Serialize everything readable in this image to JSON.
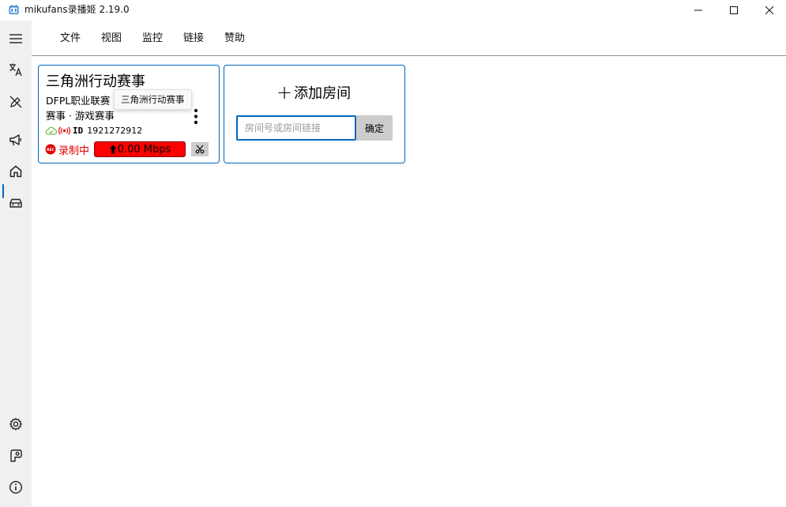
{
  "window": {
    "title": "mikufans录播姬 2.19.0",
    "controls": [
      "minimize",
      "maximize",
      "close"
    ]
  },
  "sidebar": {
    "top_items": [
      {
        "name": "hamburger-menu",
        "icon": "hamburger-icon"
      },
      {
        "name": "language",
        "icon": "translate-icon"
      },
      {
        "name": "log-settings",
        "icon": "pen-off-icon"
      },
      {
        "name": "announcement",
        "icon": "megaphone-icon"
      },
      {
        "name": "home",
        "icon": "home-icon",
        "active": true
      },
      {
        "name": "toolbox",
        "icon": "toolbox-icon"
      }
    ],
    "bottom_items": [
      {
        "name": "settings",
        "icon": "gear-icon"
      },
      {
        "name": "bilibili-link",
        "icon": "p-badge-icon"
      },
      {
        "name": "about",
        "icon": "info-icon"
      }
    ]
  },
  "menu": {
    "items": [
      "文件",
      "视图",
      "监控",
      "链接",
      "赞助"
    ]
  },
  "room_card": {
    "title": "三角洲行动赛事",
    "subtitle": "DFPL职业联赛",
    "category": "赛事 · 游戏赛事",
    "id_label": "ID",
    "room_id": "1921272912",
    "status_text": "录制中",
    "speed": "0.00 Mbps",
    "tooltip": "三角洲行动赛事",
    "colors": {
      "recording": "#e00000",
      "speed_bg": "#ff0000",
      "cloud": "#6cc04a",
      "live": "#e00000"
    }
  },
  "add_room": {
    "title": "添加房间",
    "input_placeholder": "房间号或房间链接",
    "input_value": "",
    "confirm_label": "确定"
  },
  "theme": {
    "accent": "#0067c0",
    "sidebar_bg": "#f0f0f0"
  }
}
